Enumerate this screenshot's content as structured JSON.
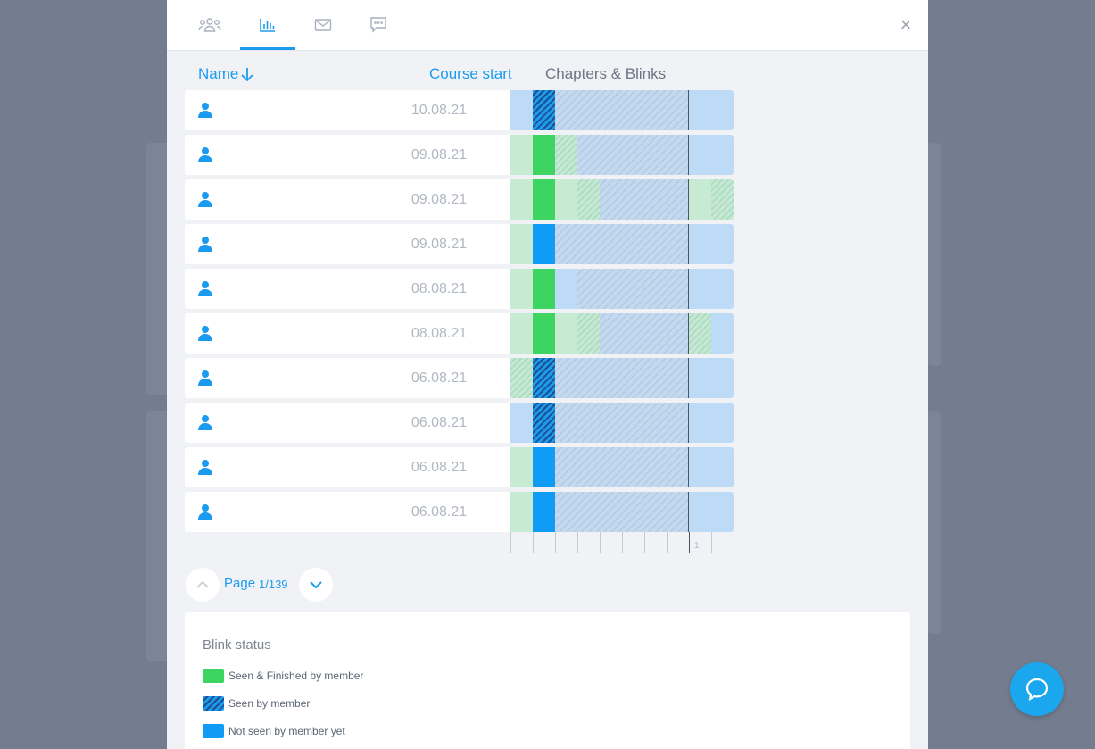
{
  "tabs": [
    {
      "name": "members",
      "icon": "members-group-icon",
      "active": false
    },
    {
      "name": "statistics",
      "icon": "bar-chart-icon",
      "active": true
    },
    {
      "name": "messages",
      "icon": "envelope-icon",
      "active": false
    },
    {
      "name": "comments",
      "icon": "chat-bubble-icon",
      "active": false
    }
  ],
  "close_label": "×",
  "table": {
    "columns": {
      "name": "Name",
      "course_start": "Course start",
      "chapters": "Chapters & Blinks"
    },
    "rows": [
      {
        "date": "10.08.21",
        "cells": [
          "not-light",
          "seen",
          "locked",
          "locked",
          "locked",
          "locked",
          "locked",
          "locked",
          "not-light",
          "not-light"
        ]
      },
      {
        "date": "09.08.21",
        "cells": [
          "fin-light",
          "finished",
          "seen-light",
          "locked",
          "locked",
          "locked",
          "locked",
          "locked",
          "not-light",
          "not-light"
        ]
      },
      {
        "date": "09.08.21",
        "cells": [
          "fin-light",
          "finished",
          "fin-light",
          "seen-light",
          "locked",
          "locked",
          "locked",
          "locked",
          "fin-light",
          "seen-light"
        ]
      },
      {
        "date": "09.08.21",
        "cells": [
          "fin-light",
          "notseen",
          "locked",
          "locked",
          "locked",
          "locked",
          "locked",
          "locked",
          "not-light",
          "not-light"
        ]
      },
      {
        "date": "08.08.21",
        "cells": [
          "fin-light",
          "finished",
          "not-light",
          "locked",
          "locked",
          "locked",
          "locked",
          "locked",
          "not-light",
          "not-light"
        ]
      },
      {
        "date": "08.08.21",
        "cells": [
          "fin-light",
          "finished",
          "fin-light",
          "seen-light",
          "locked",
          "locked",
          "locked",
          "locked",
          "seen-light",
          "not-light"
        ]
      },
      {
        "date": "06.08.21",
        "cells": [
          "seen-light",
          "seen",
          "locked",
          "locked",
          "locked",
          "locked",
          "locked",
          "locked",
          "not-light",
          "not-light"
        ]
      },
      {
        "date": "06.08.21",
        "cells": [
          "not-light",
          "seen",
          "locked",
          "locked",
          "locked",
          "locked",
          "locked",
          "locked",
          "not-light",
          "not-light"
        ]
      },
      {
        "date": "06.08.21",
        "cells": [
          "fin-light",
          "notseen",
          "locked",
          "locked",
          "locked",
          "locked",
          "locked",
          "locked",
          "not-light",
          "not-light"
        ]
      },
      {
        "date": "06.08.21",
        "cells": [
          "fin-light",
          "notseen",
          "locked",
          "locked",
          "locked",
          "locked",
          "locked",
          "locked",
          "not-light",
          "not-light"
        ]
      }
    ],
    "axis_label": "1"
  },
  "pagination": {
    "label": "Page",
    "current": "1/139"
  },
  "legend": {
    "title": "Blink status",
    "items": [
      {
        "label": "Seen & Finished by member",
        "status": "finished"
      },
      {
        "label": "Seen by member",
        "status": "seen"
      },
      {
        "label": "Not seen by member yet",
        "status": "notseen"
      }
    ]
  },
  "colors": {
    "accent": "#1a9bf0",
    "finished": "#3dd461",
    "not_seen": "#109cf5",
    "chat": "#1ba7ee"
  }
}
